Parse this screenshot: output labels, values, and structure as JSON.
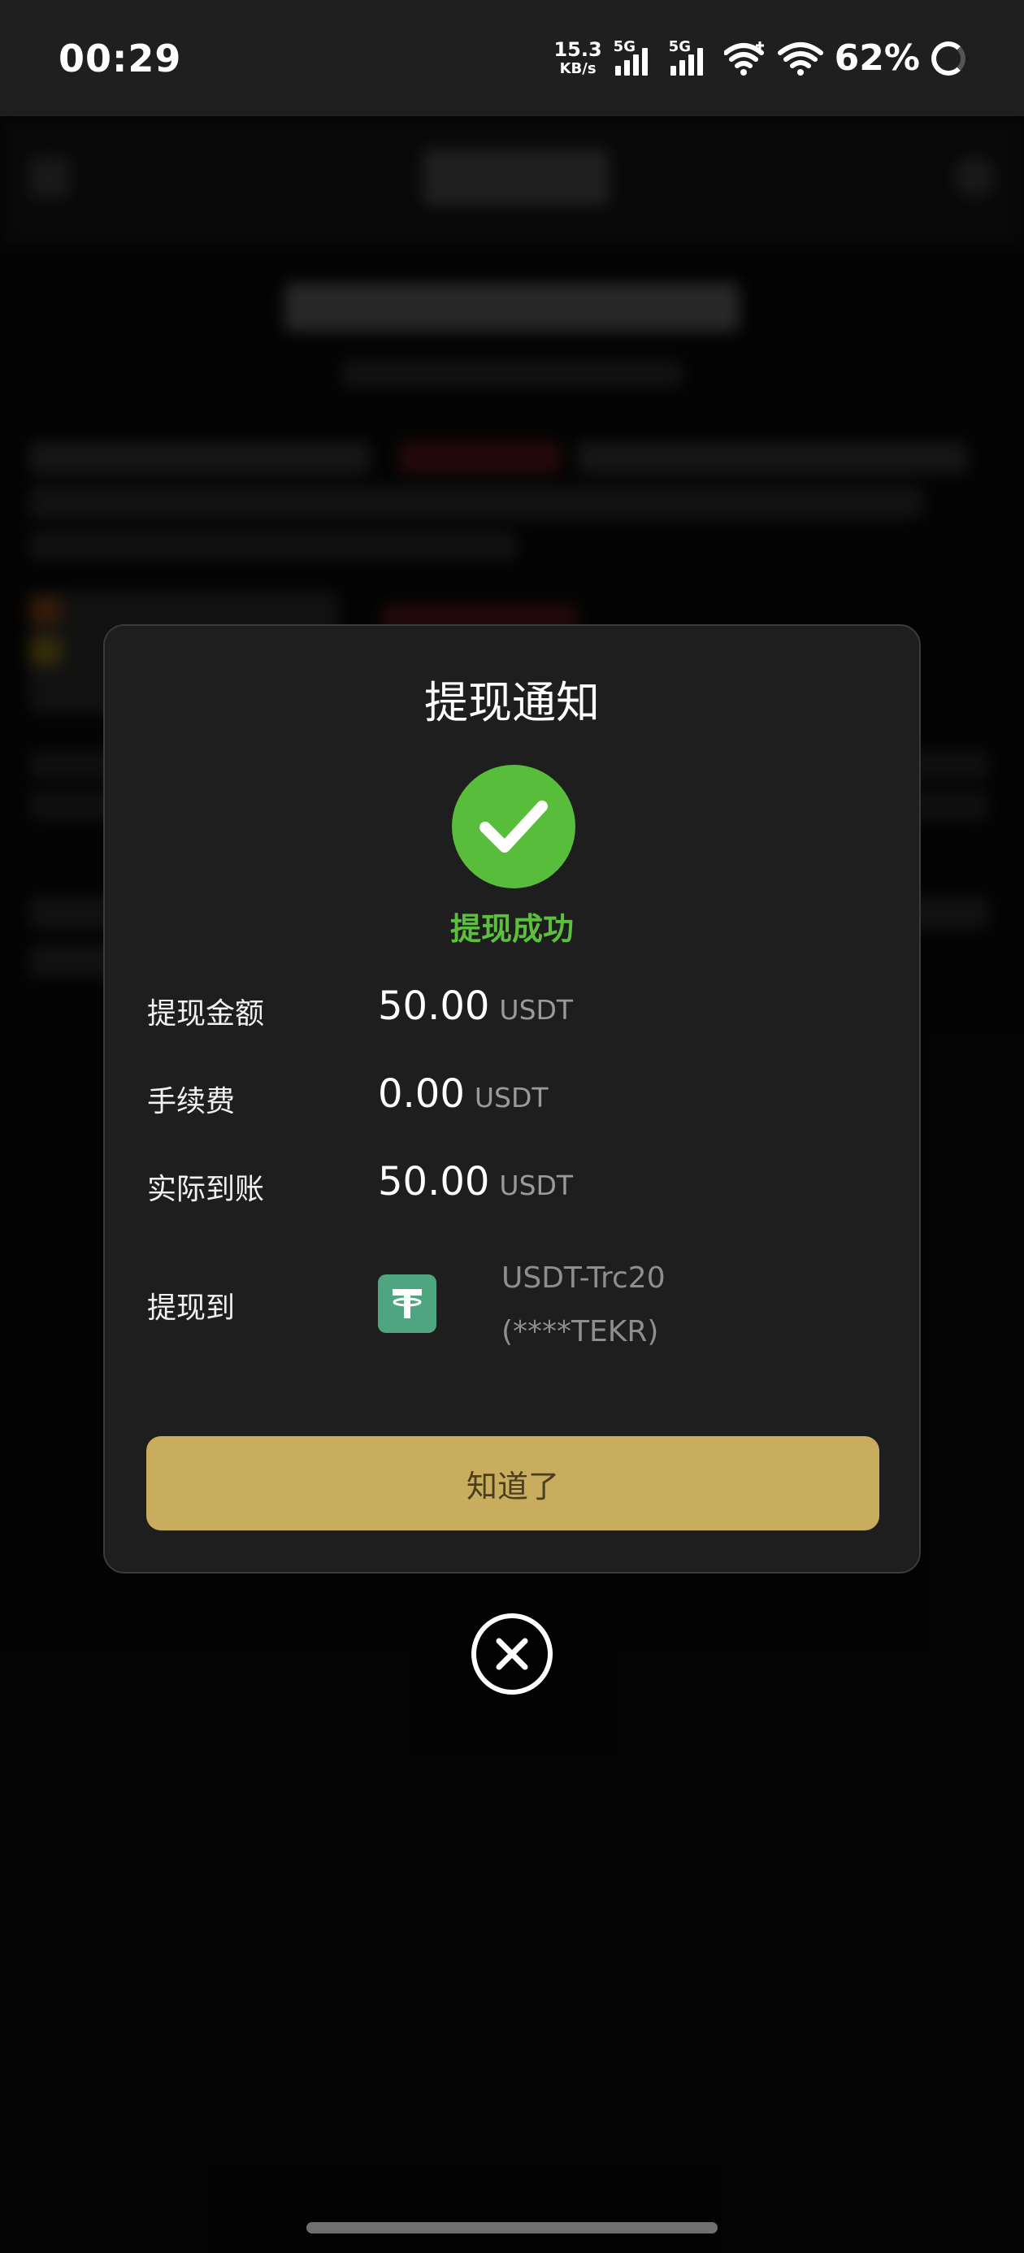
{
  "status_bar": {
    "time": "00:29",
    "net_speed_value": "15.3",
    "net_speed_unit": "KB/s",
    "sim1_tag": "5G",
    "sim2_tag": "5G",
    "battery": "62%"
  },
  "dialog": {
    "title": "提现通知",
    "success_text": "提现成功",
    "rows": [
      {
        "label": "提现金额",
        "value": "50.00",
        "unit": "USDT"
      },
      {
        "label": "手续费",
        "value": "0.00",
        "unit": "USDT"
      },
      {
        "label": "实际到账",
        "value": "50.00",
        "unit": "USDT"
      }
    ],
    "destination": {
      "label": "提现到",
      "network": "USDT-Trc20",
      "address": "(****TEKR)",
      "icon": "tether-icon"
    },
    "confirm_label": "知道了"
  },
  "colors": {
    "success": "#58bd3a",
    "button": "#c9ad5f",
    "dialog_bg": "#1e1e1e"
  }
}
